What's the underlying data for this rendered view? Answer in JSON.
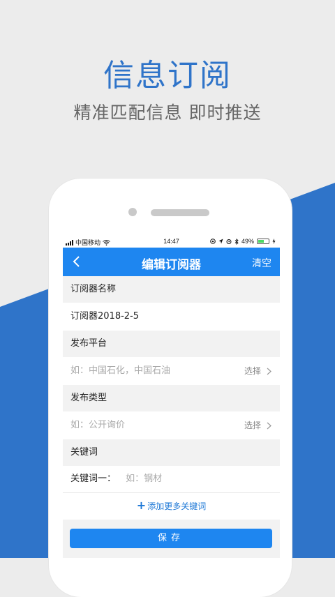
{
  "promo": {
    "title": "信息订阅",
    "subtitle": "精准匹配信息 即时推送"
  },
  "colors": {
    "brand": "#1e86f0",
    "wedge": "#2f74c9",
    "background": "#ececec"
  },
  "status_bar": {
    "carrier": "中国移动",
    "time": "14:47",
    "battery": "49%"
  },
  "nav": {
    "back_icon": "chevron-left-icon",
    "title": "编辑订阅器",
    "clear_label": "清空"
  },
  "form": {
    "name_label": "订阅器名称",
    "name_value": "订阅器2018-2-5",
    "platform_label": "发布平台",
    "platform_placeholder": "如：中国石化，中国石油",
    "platform_choose": "选择",
    "type_label": "发布类型",
    "type_placeholder": "如：公开询价",
    "type_choose": "选择",
    "keyword_section_label": "关键词",
    "keyword1_label": "关键词一：",
    "keyword1_placeholder": "如：钢材",
    "add_more_label": "添加更多关键词",
    "save_label": "保存"
  }
}
